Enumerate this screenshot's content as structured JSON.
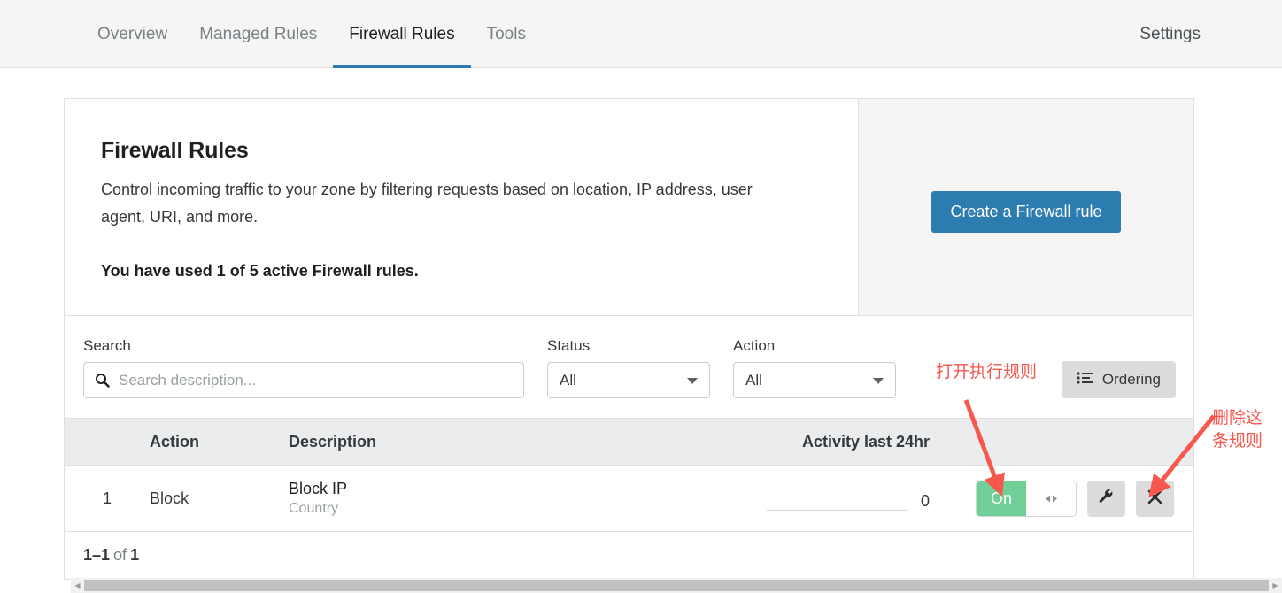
{
  "nav": {
    "tabs": [
      {
        "label": "Overview",
        "state": "muted"
      },
      {
        "label": "Managed Rules",
        "state": "muted"
      },
      {
        "label": "Firewall Rules",
        "state": "active"
      },
      {
        "label": "Tools",
        "state": "muted"
      }
    ],
    "settings_label": "Settings",
    "active_underline_color": "#2c7cb0"
  },
  "panel": {
    "title": "Firewall Rules",
    "description": "Control incoming traffic to your zone by filtering requests based on location, IP address, user agent, URI, and more.",
    "usage": "You have used 1 of 5 active Firewall rules.",
    "create_button": "Create a Firewall rule",
    "create_button_color": "#2c7cb0"
  },
  "filters": {
    "search": {
      "label": "Search",
      "placeholder": "Search description...",
      "value": "",
      "icon": "search-icon"
    },
    "status": {
      "label": "Status",
      "selected": "All"
    },
    "action": {
      "label": "Action",
      "selected": "All"
    },
    "ordering_button": {
      "label": "Ordering",
      "icon": "list-ordered-icon"
    }
  },
  "table": {
    "columns": {
      "number": "",
      "action": "Action",
      "description": "Description",
      "activity": "Activity last 24hr",
      "controls": ""
    },
    "rows": [
      {
        "number": "1",
        "action": "Block",
        "description_main": "Block IP",
        "description_sub": "Country",
        "activity_value": "0",
        "toggle_label": "On",
        "toggle_state": "on",
        "toggle_handle_icon": "left-right-arrows-icon",
        "edit_icon": "wrench-icon",
        "delete_icon": "close-x-icon"
      }
    ],
    "footer": {
      "range": "1–1",
      "of": "of",
      "total": "1"
    }
  },
  "annotations": {
    "toggle_note": "打开执行规则",
    "delete_note": "删除这\n条规则",
    "color": "#f8574e"
  },
  "scrollbar": {
    "left_arrow": "◀",
    "right_arrow": "▶"
  }
}
